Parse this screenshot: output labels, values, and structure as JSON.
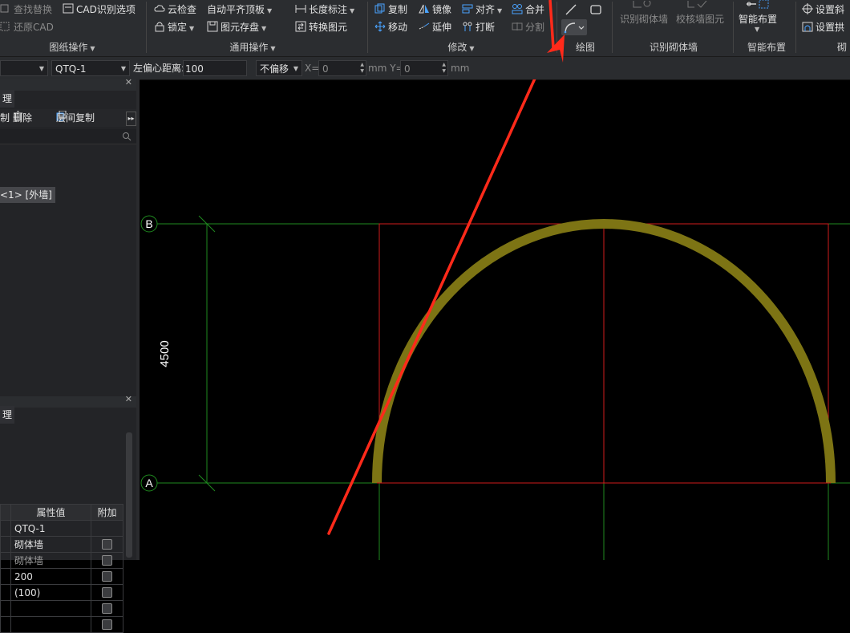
{
  "ribbon": {
    "row1": [
      {
        "label": "查找替换",
        "icon": "find-replace-icon",
        "disabled": true
      },
      {
        "label": "CAD识别选项",
        "icon": "cad-options-icon"
      },
      {
        "label": "云检查",
        "icon": "cloud-check-icon"
      },
      {
        "label": "自动平齐顶板",
        "dropdown": true
      },
      {
        "label": "长度标注",
        "icon": "dimension-icon",
        "dropdown": true
      },
      {
        "label": "复制",
        "icon": "copy-icon"
      },
      {
        "label": "镜像",
        "icon": "mirror-icon"
      },
      {
        "label": "对齐",
        "icon": "align-icon",
        "dropdown": true
      },
      {
        "label": "合并",
        "icon": "merge-icon"
      }
    ],
    "row2": [
      {
        "label": "还原CAD",
        "icon": "restore-cad-icon",
        "disabled": true
      },
      {
        "label": "锁定",
        "icon": "lock-icon",
        "dropdown": true
      },
      {
        "label": "图元存盘",
        "icon": "save-element-icon",
        "dropdown": true
      },
      {
        "label": "转换图元",
        "icon": "convert-element-icon"
      },
      {
        "label": "移动",
        "icon": "move-icon"
      },
      {
        "label": "延伸",
        "icon": "extend-icon"
      },
      {
        "label": "打断",
        "icon": "break-icon"
      },
      {
        "label": "分割",
        "icon": "split-icon",
        "disabled": true
      }
    ],
    "big": [
      {
        "label": "识别砌体墙"
      },
      {
        "label": "校核墙图元"
      },
      {
        "label": "智能布置"
      }
    ],
    "right": [
      {
        "label": "设置斜"
      },
      {
        "label": "设置拱"
      }
    ],
    "groups": {
      "drawing_ops": "图纸操作",
      "general_ops": "通用操作",
      "modify": "修改",
      "draw": "绘图",
      "identify_wall": "识别砌体墙",
      "smart_layout": "智能布置",
      "right_cut": "砌"
    }
  },
  "toolbar": {
    "name_value": "QTQ-1",
    "offset_label": "左偏心距离:",
    "offset_value": "100",
    "offset_mode": "不偏移",
    "x_label": "X=",
    "x_value": "0",
    "unit_mm": "mm",
    "y_label": "mm Y=",
    "y_value": "0"
  },
  "left_panel": {
    "tab1": "理",
    "btn_copy_tail": "制",
    "btn_delete": "删除",
    "btn_floor_copy": "层间复制",
    "tree_item": "<1> [外墙]",
    "tab2": "理",
    "props_header": [
      "属性值",
      "附加"
    ],
    "props_rows": [
      {
        "value": "QTQ-1",
        "check": false
      },
      {
        "value": "砌体墙",
        "check": true
      },
      {
        "value": "砌体墙",
        "check": true,
        "dim": true
      },
      {
        "value": "200",
        "check": true
      },
      {
        "value": "(100)",
        "check": true
      },
      {
        "value": "",
        "check": true
      },
      {
        "value": "",
        "check": true
      }
    ]
  },
  "canvas": {
    "axis_a": "A",
    "axis_b": "B",
    "dimension": "4500",
    "colors": {
      "grid": "#1f8a1f",
      "frame": "#d01c1c",
      "wall": "#7d7414",
      "arrow": "#ff2a1a"
    }
  }
}
